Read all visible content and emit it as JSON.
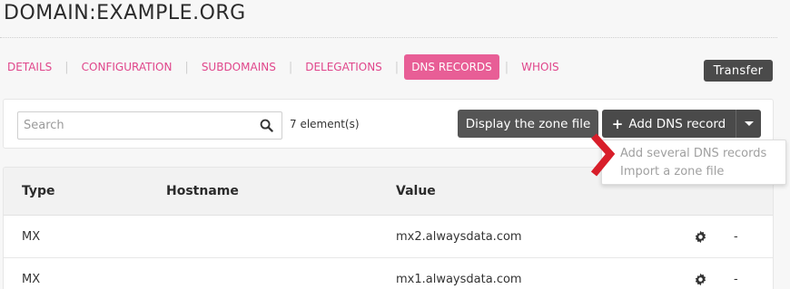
{
  "page": {
    "title": "DOMAIN:EXAMPLE.ORG"
  },
  "tabs": [
    {
      "label": "DETAILS",
      "active": false
    },
    {
      "label": "CONFIGURATION",
      "active": false
    },
    {
      "label": "SUBDOMAINS",
      "active": false
    },
    {
      "label": "DELEGATIONS",
      "active": false
    },
    {
      "label": "DNS RECORDS",
      "active": true
    },
    {
      "label": "WHOIS",
      "active": false
    }
  ],
  "tab_separator": "|",
  "transfer_button": {
    "label": "Transfer"
  },
  "search": {
    "placeholder": "Search",
    "value": "",
    "icon": "search-icon"
  },
  "element_count": "7 element(s)",
  "buttons": {
    "display_zone": "Display the zone file",
    "add_dns_plus": "+",
    "add_dns_record": "Add DNS record",
    "caret_icon": "caret-down-icon"
  },
  "dropdown": {
    "items": [
      "Add several DNS records",
      "Import a zone file"
    ]
  },
  "table": {
    "columns": [
      "Type",
      "Hostname",
      "Value"
    ],
    "rows": [
      {
        "type": "MX",
        "hostname": "",
        "value": "mx2.alwaysdata.com",
        "extra": "-"
      },
      {
        "type": "MX",
        "hostname": "",
        "value": "mx1.alwaysdata.com",
        "extra": "-"
      }
    ]
  },
  "colors": {
    "accent": "#e85e96",
    "tab_text": "#e0468b",
    "dark_button": "#4a4a4a",
    "pointer_arrow": "#d81e2a"
  }
}
